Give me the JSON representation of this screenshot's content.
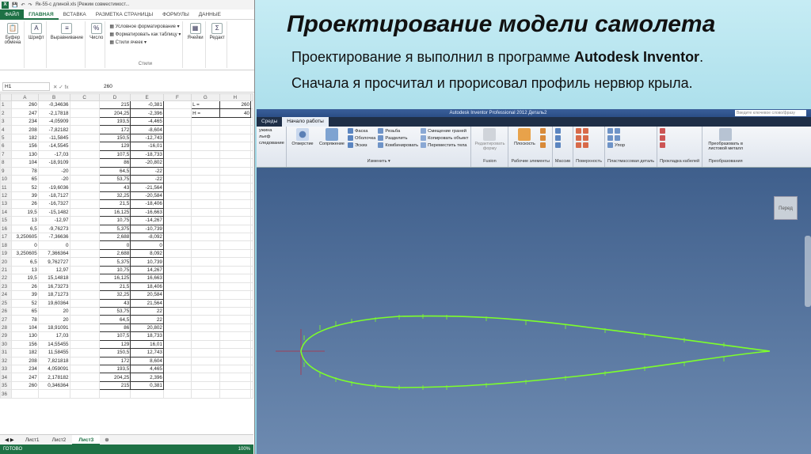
{
  "slide": {
    "title": "Проектирование модели самолета",
    "line1_prefix": "Проектирование я выполнил в программе ",
    "line1_bold": "Autodesk Inventor",
    "line1_suffix": ".",
    "line2": "Сначала я просчитал и прорисовал профиль нервюр крыла."
  },
  "excel": {
    "file_title": "Як-55-с длиной.xls [Режим совместимост...",
    "tabs": [
      "ФАЙЛ",
      "ГЛАВНАЯ",
      "ВСТАВКА",
      "РАЗМЕТКА СТРАНИЦЫ",
      "ФОРМУЛЫ",
      "ДАННЫЕ"
    ],
    "active_tab": "ГЛАВНАЯ",
    "ribbon": {
      "clipboard": "Буфер обмена",
      "font": "Шрифт",
      "align": "Выравнивание",
      "number": "Число",
      "cond_format": "Условное форматирование",
      "format_table": "Форматировать как таблицу",
      "cell_styles": "Стили ячеек",
      "styles_group": "Стили",
      "cells": "Ячейки",
      "editing": "Редакт"
    },
    "name_box": "H1",
    "fx_value": "260",
    "columns": [
      "A",
      "B",
      "C",
      "D",
      "E",
      "F",
      "G",
      "H"
    ],
    "rows": [
      [
        "260",
        "-0,34636",
        "",
        "215",
        "-0,381",
        "",
        "L =",
        "260"
      ],
      [
        "247",
        "-2,17818",
        "",
        "204,25",
        "-2,396",
        "",
        "H =",
        "40"
      ],
      [
        "234",
        "-4,05909",
        "",
        "193,5",
        "-4,465",
        "",
        "",
        ""
      ],
      [
        "208",
        "-7,82182",
        "",
        "172",
        "-8,604",
        "",
        "",
        ""
      ],
      [
        "182",
        "-11,5845",
        "",
        "150,5",
        "-12,743",
        "",
        "",
        ""
      ],
      [
        "156",
        "-14,5545",
        "",
        "129",
        "-16,01",
        "",
        "",
        ""
      ],
      [
        "130",
        "-17,03",
        "",
        "107,5",
        "-18,733",
        "",
        "",
        ""
      ],
      [
        "104",
        "-18,9109",
        "",
        "86",
        "-20,802",
        "",
        "",
        ""
      ],
      [
        "78",
        "-20",
        "",
        "64,5",
        "-22",
        "",
        "",
        ""
      ],
      [
        "65",
        "-20",
        "",
        "53,75",
        "-22",
        "",
        "",
        ""
      ],
      [
        "52",
        "-19,6036",
        "",
        "43",
        "-21,564",
        "",
        "",
        ""
      ],
      [
        "39",
        "-18,7127",
        "",
        "32,25",
        "-20,584",
        "",
        "",
        ""
      ],
      [
        "26",
        "-16,7327",
        "",
        "21,5",
        "-18,406",
        "",
        "",
        ""
      ],
      [
        "19,5",
        "-15,1482",
        "",
        "16,125",
        "-16,663",
        "",
        "",
        ""
      ],
      [
        "13",
        "-12,97",
        "",
        "10,75",
        "-14,267",
        "",
        "",
        ""
      ],
      [
        "6,5",
        "-9,76273",
        "",
        "5,375",
        "-10,739",
        "",
        "",
        ""
      ],
      [
        "3,250605",
        "-7,36636",
        "",
        "2,688",
        "-8,092",
        "",
        "",
        ""
      ],
      [
        "0",
        "0",
        "",
        "0",
        "0",
        "",
        "",
        ""
      ],
      [
        "3,250605",
        "7,366364",
        "",
        "2,688",
        "8,092",
        "",
        "",
        ""
      ],
      [
        "6,5",
        "9,762727",
        "",
        "5,375",
        "10,739",
        "",
        "",
        ""
      ],
      [
        "13",
        "12,97",
        "",
        "10,75",
        "14,267",
        "",
        "",
        ""
      ],
      [
        "19,5",
        "15,14818",
        "",
        "16,125",
        "16,663",
        "",
        "",
        ""
      ],
      [
        "26",
        "16,73273",
        "",
        "21,5",
        "18,406",
        "",
        "",
        ""
      ],
      [
        "39",
        "18,71273",
        "",
        "32,25",
        "20,584",
        "",
        "",
        ""
      ],
      [
        "52",
        "19,60364",
        "",
        "43",
        "21,564",
        "",
        "",
        ""
      ],
      [
        "65",
        "20",
        "",
        "53,75",
        "22",
        "",
        "",
        ""
      ],
      [
        "78",
        "20",
        "",
        "64,5",
        "22",
        "",
        "",
        ""
      ],
      [
        "104",
        "18,91091",
        "",
        "86",
        "20,802",
        "",
        "",
        ""
      ],
      [
        "130",
        "17,03",
        "",
        "107,5",
        "18,733",
        "",
        "",
        ""
      ],
      [
        "156",
        "14,55455",
        "",
        "129",
        "16,01",
        "",
        "",
        ""
      ],
      [
        "182",
        "11,58455",
        "",
        "150,5",
        "12,743",
        "",
        "",
        ""
      ],
      [
        "208",
        "7,821818",
        "",
        "172",
        "8,604",
        "",
        "",
        ""
      ],
      [
        "234",
        "4,059091",
        "",
        "193,5",
        "4,465",
        "",
        "",
        ""
      ],
      [
        "247",
        "2,178182",
        "",
        "204,25",
        "2,396",
        "",
        "",
        ""
      ],
      [
        "260",
        "0,346364",
        "",
        "215",
        "0,381",
        "",
        "",
        ""
      ],
      [
        "",
        "",
        "",
        "",
        "",
        "",
        "",
        ""
      ]
    ],
    "sheets": [
      "Лист1",
      "Лист2",
      "Лист3"
    ],
    "active_sheet": "Лист3",
    "status": "ГОТОВО",
    "zoom": "100%"
  },
  "inventor": {
    "window_title": "Autodesk Inventor Professional 2012   Деталь2",
    "search_placeholder": "Введите ключевое слово/фразу",
    "tabs": [
      "Среды",
      "Начало работы"
    ],
    "ribbon": {
      "partial_items": [
        "ужина",
        "льеф",
        "следование"
      ],
      "big_items": [
        "Отверстие",
        "Сопряжение"
      ],
      "col1": [
        "Фаска",
        "Оболочка",
        "Эскиз"
      ],
      "col2": [
        "Резьба",
        "Разделить",
        "Комбинировать"
      ],
      "col3": [
        "Смещение граней",
        "Копировать объект",
        "Переместить тела"
      ],
      "modify_group": "Изменить ▾",
      "fusion_item": "Редактировать форму",
      "fusion_group": "Fusion",
      "plane": "Плоскость",
      "work_group": "Рабочие элементы",
      "mass_group": "Массив",
      "surface_group": "Поверхность",
      "sheet_group": "Пластмассовая деталь",
      "cable_group": "Прокладка кабелей",
      "convert_group": "Преобразования",
      "rib": "Упор",
      "convert": "Преобразовать в листовой металл"
    },
    "viewcube": "Перед"
  }
}
